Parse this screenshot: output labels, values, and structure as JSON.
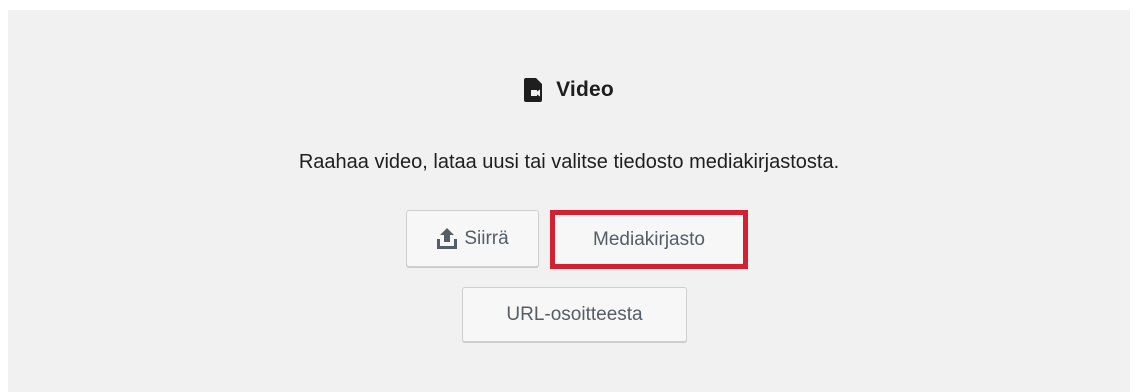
{
  "placeholder": {
    "icon": "video-file-icon",
    "title": "Video",
    "instructions": "Raahaa video, lataa uusi tai valitse tiedosto mediakirjastosta."
  },
  "buttons": {
    "upload_icon": "upload-icon",
    "upload_label": "Siirrä",
    "media_library_label": "Mediakirjasto",
    "url_label": "URL-osoitteesta"
  },
  "highlight": {
    "color": "#d42031",
    "target": "media-library-button"
  }
}
